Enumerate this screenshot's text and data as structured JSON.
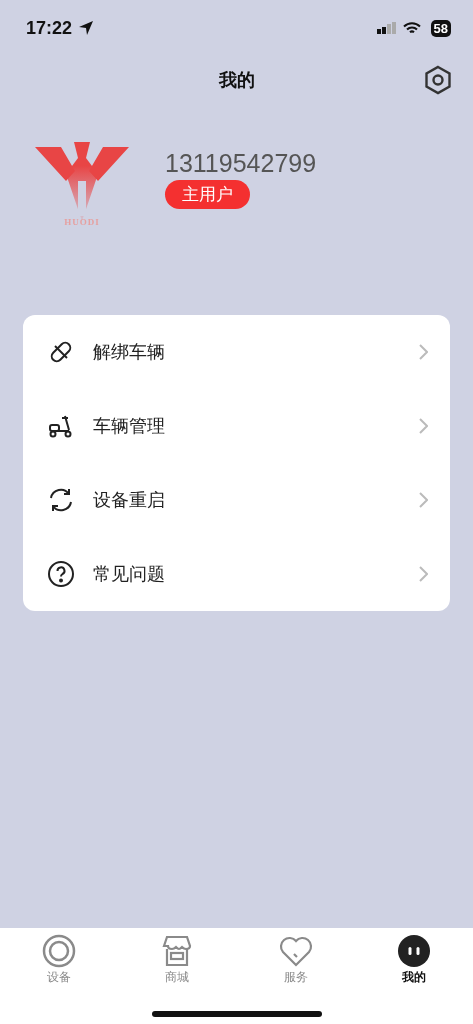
{
  "status_bar": {
    "time": "17:22",
    "battery": "58"
  },
  "header": {
    "title": "我的"
  },
  "profile": {
    "logo_text": "HUODI",
    "phone": "13119542799",
    "role": "主用户"
  },
  "menu": [
    {
      "kind": "unbind",
      "label": "解绑车辆"
    },
    {
      "kind": "scooter",
      "label": "车辆管理"
    },
    {
      "kind": "restart",
      "label": "设备重启"
    },
    {
      "kind": "help",
      "label": "常见问题"
    }
  ],
  "tabs": [
    {
      "kind": "device",
      "label": "设备",
      "selected": false
    },
    {
      "kind": "shop",
      "label": "商城",
      "selected": false
    },
    {
      "kind": "service",
      "label": "服务",
      "selected": false
    },
    {
      "kind": "me",
      "label": "我的",
      "selected": true
    }
  ]
}
